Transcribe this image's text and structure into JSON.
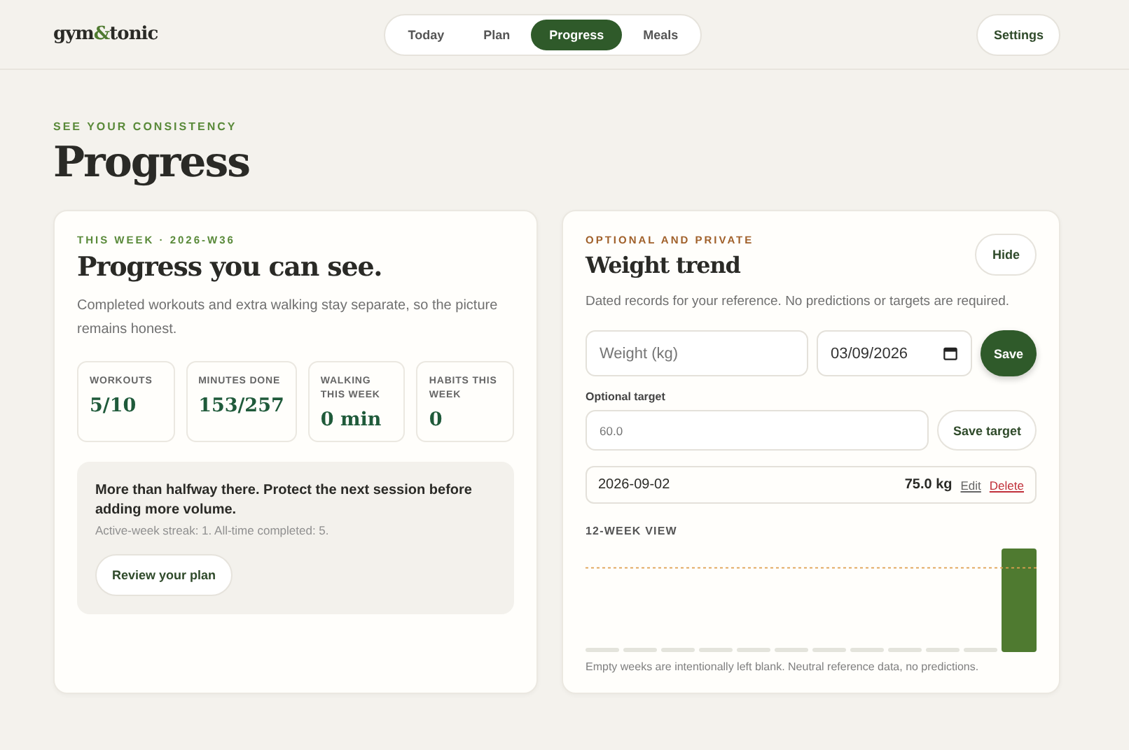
{
  "header": {
    "logo": {
      "before": "gym",
      "amp": "&",
      "after": "tonic"
    },
    "tabs": [
      {
        "label": "Today",
        "selected": false
      },
      {
        "label": "Plan",
        "selected": false
      },
      {
        "label": "Progress",
        "selected": true
      },
      {
        "label": "Meals",
        "selected": false
      }
    ],
    "settings_button": "Settings"
  },
  "page": {
    "eyebrow": "SEE YOUR CONSISTENCY",
    "title": "Progress"
  },
  "week_card": {
    "eyebrow": "THIS WEEK · 2026-W36",
    "title": "Progress you can see.",
    "description": "Completed workouts and extra walking stay separate, so the picture remains honest.",
    "stats": [
      {
        "label": "WORKOUTS",
        "value": "5/10"
      },
      {
        "label": "MINUTES DONE",
        "value": "153/257"
      },
      {
        "label": "WALKING THIS WEEK",
        "value": "0 min"
      },
      {
        "label": "HABITS THIS WEEK",
        "value": "0"
      }
    ],
    "note": {
      "message": "More than halfway there. Protect the next session before adding more volume.",
      "detail": "Active-week streak: 1. All-time completed: 5.",
      "button": "Review your plan"
    }
  },
  "weight_card": {
    "eyebrow": "OPTIONAL AND PRIVATE",
    "title": "Weight trend",
    "hide_button": "Hide",
    "description": "Dated records for your reference. No predictions or targets are required.",
    "weight_field": {
      "placeholder": "Weight (kg)"
    },
    "date_field": {
      "value": "03/09/2026"
    },
    "save_button": "Save",
    "target_label": "Optional target",
    "target_field": {
      "placeholder": "60.0"
    },
    "save_target_button": "Save target",
    "records": [
      {
        "date": "2026-09-02",
        "weight": "75.0 kg",
        "edit": "Edit",
        "delete": "Delete"
      }
    ],
    "chart_title": "12-WEEK VIEW",
    "chart_note": "Empty weeks are intentionally left blank. Neutral reference data, no predictions."
  }
}
